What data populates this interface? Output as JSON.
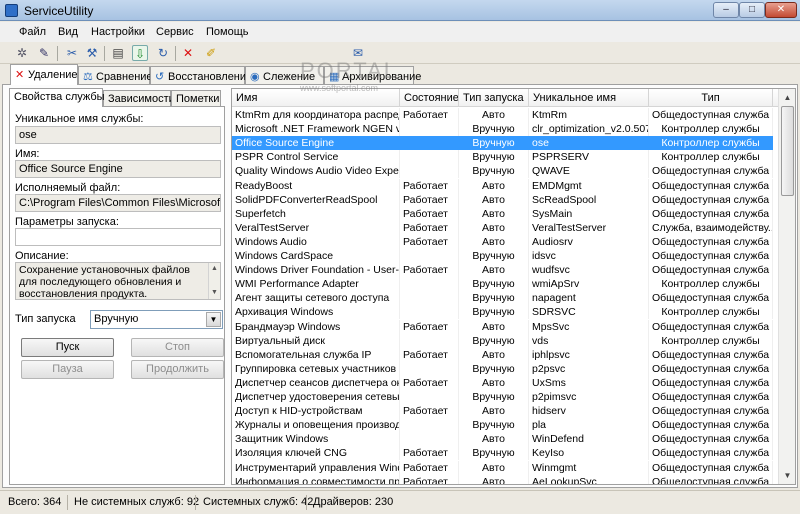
{
  "window": {
    "title": "ServiceUtility",
    "min": "–",
    "max": "□",
    "close": "✕"
  },
  "menu": [
    "Файл",
    "Вид",
    "Настройки",
    "Сервис",
    "Помощь"
  ],
  "toolbar_icons": [
    "✲",
    "✎",
    "✂",
    "⚒",
    "▤",
    "⇩",
    "↻",
    "✕",
    "✐",
    "✉"
  ],
  "watermark": {
    "big": "PORTAL",
    "small": "www.softportal.com"
  },
  "tabs": [
    {
      "label": "Удаление",
      "icon": "✕"
    },
    {
      "label": "Сравнение",
      "icon": "⚖"
    },
    {
      "label": "Восстановление",
      "icon": "↺"
    },
    {
      "label": "Слежение",
      "icon": "◉"
    },
    {
      "label": "Архивирование",
      "icon": "▦"
    }
  ],
  "subtabs": [
    "Свойства службы",
    "Зависимости",
    "Пометки"
  ],
  "props": {
    "unique_label": "Уникальное имя службы:",
    "unique_value": "ose",
    "name_label": "Имя:",
    "name_value": "Office Source Engine",
    "exe_label": "Исполняемый файл:",
    "exe_value": "C:\\Program Files\\Common Files\\Microsoft Shared\\Source Engine\\OSE.EXE",
    "params_label": "Параметры запуска:",
    "params_value": "",
    "desc_label": "Описание:",
    "desc_value": "Сохранение установочных файлов для последующего обновления и восстановления продукта. Используется",
    "start_label": "Тип запуска",
    "start_value": "Вручную",
    "buttons": {
      "start": "Пуск",
      "stop": "Стоп",
      "pause": "Пауза",
      "resume": "Продолжить"
    }
  },
  "columns": [
    "Имя",
    "Состояние",
    "Тип запуска",
    "Уникальное имя",
    "Тип"
  ],
  "rows": [
    [
      "KtmRm для координатора распреде...",
      "Работает",
      "Авто",
      "KtmRm",
      "Общедоступная служба"
    ],
    [
      "Microsoft .NET Framework NGEN v2....",
      "",
      "Вручную",
      "clr_optimization_v2.0.507...",
      "Контроллер службы"
    ],
    [
      "Office Source Engine",
      "",
      "Вручную",
      "ose",
      "Контроллер службы"
    ],
    [
      "PSPR Control Service",
      "",
      "Вручную",
      "PSPRSERV",
      "Контроллер службы"
    ],
    [
      "Quality Windows Audio Video Experien...",
      "",
      "Вручную",
      "QWAVE",
      "Общедоступная служба"
    ],
    [
      "ReadyBoost",
      "Работает",
      "Авто",
      "EMDMgmt",
      "Общедоступная служба"
    ],
    [
      "SolidPDFConverterReadSpool",
      "Работает",
      "Авто",
      "ScReadSpool",
      "Общедоступная служба"
    ],
    [
      "Superfetch",
      "Работает",
      "Авто",
      "SysMain",
      "Общедоступная служба"
    ],
    [
      "VeralTestServer",
      "Работает",
      "Авто",
      "VeralTestServer",
      "Служба, взаимодейству..."
    ],
    [
      "Windows Audio",
      "Работает",
      "Авто",
      "Audiosrv",
      "Общедоступная служба"
    ],
    [
      "Windows CardSpace",
      "",
      "Вручную",
      "idsvc",
      "Общедоступная служба"
    ],
    [
      "Windows Driver Foundation - User-mo...",
      "Работает",
      "Авто",
      "wudfsvc",
      "Общедоступная служба"
    ],
    [
      "WMI Performance Adapter",
      "",
      "Вручную",
      "wmiApSrv",
      "Контроллер службы"
    ],
    [
      "Агент защиты сетевого доступа",
      "",
      "Вручную",
      "napagent",
      "Общедоступная служба"
    ],
    [
      "Архивация Windows",
      "",
      "Вручную",
      "SDRSVC",
      "Контроллер службы"
    ],
    [
      "Брандмауэр Windows",
      "Работает",
      "Авто",
      "MpsSvc",
      "Общедоступная служба"
    ],
    [
      "Виртуальный диск",
      "",
      "Вручную",
      "vds",
      "Контроллер службы"
    ],
    [
      "Вспомогательная служба IP",
      "Работает",
      "Авто",
      "iphlpsvc",
      "Общедоступная служба"
    ],
    [
      "Группировка сетевых участников",
      "",
      "Вручную",
      "p2psvc",
      "Общедоступная служба"
    ],
    [
      "Диспетчер сеансов диспетчера око...",
      "Работает",
      "Авто",
      "UxSms",
      "Общедоступная служба"
    ],
    [
      "Диспетчер удостоверения сетевых ...",
      "",
      "Вручную",
      "p2pimsvc",
      "Общедоступная служба"
    ],
    [
      "Доступ к HID-устройствам",
      "Работает",
      "Авто",
      "hidserv",
      "Общедоступная служба"
    ],
    [
      "Журналы и оповещения производи...",
      "",
      "Вручную",
      "pla",
      "Общедоступная служба"
    ],
    [
      "Защитник Windows",
      "",
      "Авто",
      "WinDefend",
      "Общедоступная служба"
    ],
    [
      "Изоляция ключей CNG",
      "Работает",
      "Вручную",
      "KeyIso",
      "Общедоступная служба"
    ],
    [
      "Инструментарий управления Windo...",
      "Работает",
      "Авто",
      "Winmgmt",
      "Общедоступная служба"
    ],
    [
      "Информация о совместимости при...",
      "Работает",
      "Авто",
      "AeLookupSvc",
      "Общедоступная служба"
    ]
  ],
  "selected_row": 2,
  "status": {
    "total": "Всего: 364",
    "nonsystem": "Не системных служб: 92",
    "system": "Системных служб: 42",
    "drivers": "Драйверов: 230"
  },
  "colors": {
    "selection": "#3399ff"
  }
}
